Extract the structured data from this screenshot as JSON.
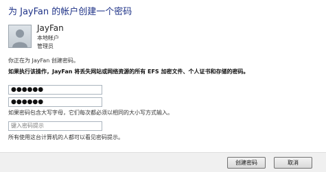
{
  "dialog": {
    "title": "为 JayFan 的帐户创建一个密码"
  },
  "account": {
    "name": "JayFan",
    "type": "本地帐户",
    "role": "管理员",
    "avatar_icon": "user-silhouette-icon"
  },
  "messages": {
    "status": "你正在为 JayFan 创建密码。",
    "warning": "如果执行该操作，JayFan 将丢失网站或网络资源的所有 EFS 加密文件、个人证书和存储的密码。",
    "case_note": "如果密码包含大写字母，它们每次都必须以相同的大小写方式输入。",
    "hint_note": "所有使用这台计算机的人都可以看见密码提示。"
  },
  "form": {
    "new_password_value": "●●●●●●",
    "confirm_password_value": "●●●●●●",
    "hint_placeholder": "键入密码提示"
  },
  "buttons": {
    "create_label": "创建密码",
    "cancel_label": "取消"
  },
  "colors": {
    "title": "#1e3287",
    "footer_bg": "#f0f0f0",
    "field_border": "#a9b3bd"
  }
}
